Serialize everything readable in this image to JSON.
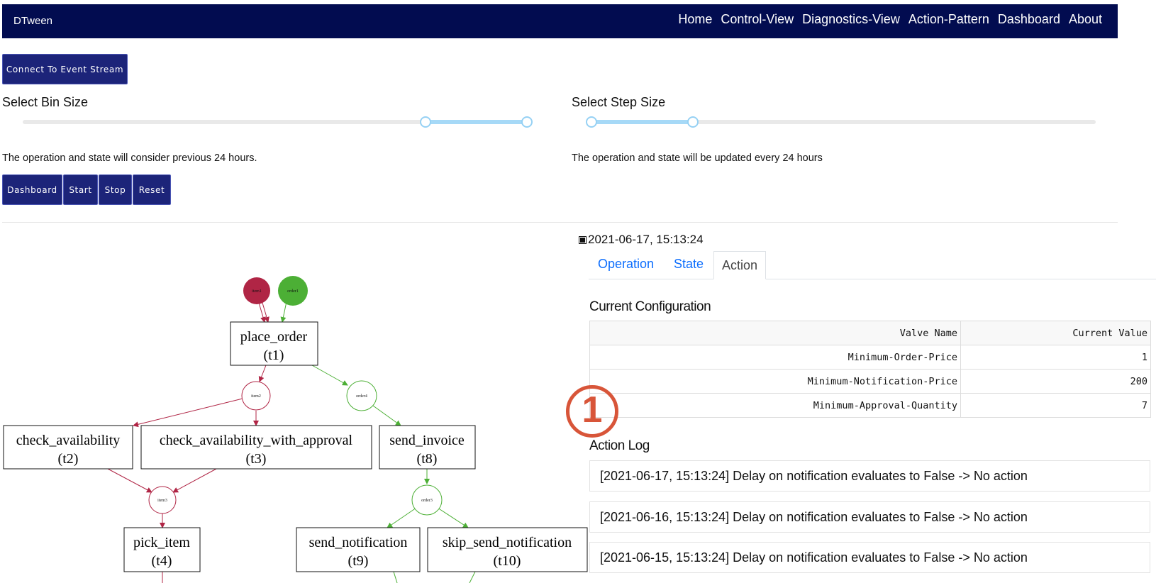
{
  "app": {
    "brand": "DTween"
  },
  "nav": {
    "items": [
      "Home",
      "Control-View",
      "Diagnostics-View",
      "Action-Pattern",
      "Dashboard",
      "About"
    ]
  },
  "controls": {
    "connect_label": "Connect To Event Stream",
    "bin_size_label": "Select Bin Size",
    "step_size_label": "Select Step Size",
    "bin_description": "The operation and state will consider previous 24 hours.",
    "step_description": "The operation and state will be updated every 24 hours",
    "buttons": {
      "dashboard": "Dashboard",
      "start": "Start",
      "stop": "Stop",
      "reset": "Reset"
    }
  },
  "panel": {
    "timestamp": "2021-06-17, 15:13:24",
    "tabs": {
      "operation": "Operation",
      "state": "State",
      "action": "Action"
    },
    "active_tab": "Action",
    "config_title": "Current Configuration",
    "config_headers": [
      "Valve Name",
      "Current Value"
    ],
    "config_rows": [
      [
        "Minimum-Order-Price",
        "1"
      ],
      [
        "Minimum-Notification-Price",
        "200"
      ],
      [
        "Minimum-Approval-Quantity",
        "7"
      ]
    ],
    "log_title": "Action Log",
    "log_entries": [
      "[2021-06-17, 15:13:24] Delay on notification evaluates to False -> No action",
      "[2021-06-16, 15:13:24] Delay on notification evaluates to False -> No action",
      "[2021-06-15, 15:13:24] Delay on notification evaluates to False -> No action"
    ]
  },
  "annotation": {
    "number": "1",
    "color": "#d85539"
  },
  "graph": {
    "places": {
      "item1": "item1",
      "order1": "order1",
      "item2": "item2",
      "order4": "order4",
      "item3": "item3",
      "order3": "order3"
    },
    "transitions": {
      "t1": [
        "place_order",
        "(t1)"
      ],
      "t2": [
        "check_availability",
        "(t2)"
      ],
      "t3": [
        "check_availability_with_approval",
        "(t3)"
      ],
      "t8": [
        "send_invoice",
        "(t8)"
      ],
      "t4": [
        "pick_item",
        "(t4)"
      ],
      "t9": [
        "send_notification",
        "(t9)"
      ],
      "t10": [
        "skip_send_notification",
        "(t10)"
      ]
    },
    "colors": {
      "item": "#b02545",
      "order": "#4caf35"
    }
  },
  "sliders": {
    "bin_size": {
      "selected_fraction": [
        0.79,
        1.0
      ]
    },
    "step_size": {
      "selected_fraction": [
        0.0,
        0.2
      ]
    }
  }
}
